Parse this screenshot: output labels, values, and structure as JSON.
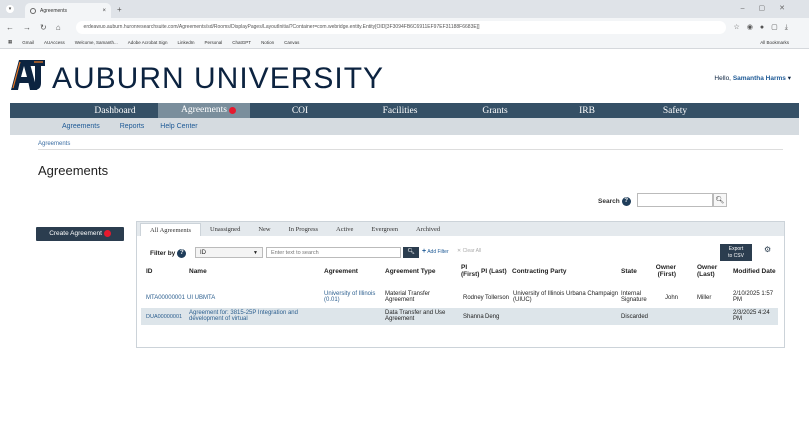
{
  "browser": {
    "tab_title": "Agreements",
    "url": "erdeawuo.auburn.huronresearchsuite.com/Agreements/sd/Rooms/DisplayPages/LayoutInitial?Container=com.webridge.entity.Entity[OID[3F3094FB6C6911EF97EF31188F6683E]]",
    "bookmarks": [
      "Gmail",
      "AUAccess",
      "Welcome, Samanth...",
      "Adobe Acrobat Sign",
      "LinkedIn",
      "Personal",
      "ChatGPT",
      "Notion",
      "Canvas"
    ],
    "all_bookmarks": "All Bookmarks"
  },
  "header": {
    "university": "AUBURN UNIVERSITY",
    "hello": "Hello,",
    "user": "Samantha Harms"
  },
  "main_nav": [
    "Dashboard",
    "Agreements",
    "COI",
    "Facilities",
    "Grants",
    "IRB",
    "Safety"
  ],
  "sub_nav": [
    "Agreements",
    "Reports",
    "Help Center"
  ],
  "breadcrumb": "Agreements",
  "page_title": "Agreements",
  "search": {
    "label": "Search",
    "placeholder": ""
  },
  "create_button": "Create Agreement",
  "tabs": [
    "All Agreements",
    "Unassigned",
    "New",
    "In Progress",
    "Active",
    "Evergreen",
    "Archived"
  ],
  "filter": {
    "label": "Filter by",
    "field": "ID",
    "placeholder": "Enter text to search",
    "add_filter": "Add Filter",
    "clear_all": "Clear All"
  },
  "export": {
    "line1": "Export",
    "line2": "to CSV"
  },
  "columns": [
    "ID",
    "Name",
    "Agreement",
    "Agreement Type",
    "PI (First)",
    "PI (Last)",
    "Contracting Party",
    "State",
    "Owner (First)",
    "Owner (Last)",
    "Modified Date"
  ],
  "rows": [
    {
      "id": "MTA00000001",
      "name": "UI UBMTA",
      "agreement": "University of Illinois (0.01)",
      "type": "Material Transfer Agreement",
      "pi_first": "Rodney",
      "pi_last": "Tollerson",
      "party": "University of Illinois Urbana Champaign (UIUC)",
      "state": "Internal Signature",
      "owner_first": "John",
      "owner_last": "Miller",
      "modified": "2/10/2025 1:57 PM"
    },
    {
      "id": "DUA00000001",
      "name": "Agreement for: 3815-25P Integration and development of virtual",
      "agreement": "",
      "type": "Data Transfer and Use Agreement",
      "pi_first": "Shanna",
      "pi_last": "Deng",
      "party": "",
      "state": "Discarded",
      "owner_first": "",
      "owner_last": "",
      "modified": "2/3/2025 4:24 PM"
    }
  ],
  "colors": {
    "navy": "#0c2340",
    "nav": "#355066",
    "orange_dot": "#e6192e"
  }
}
